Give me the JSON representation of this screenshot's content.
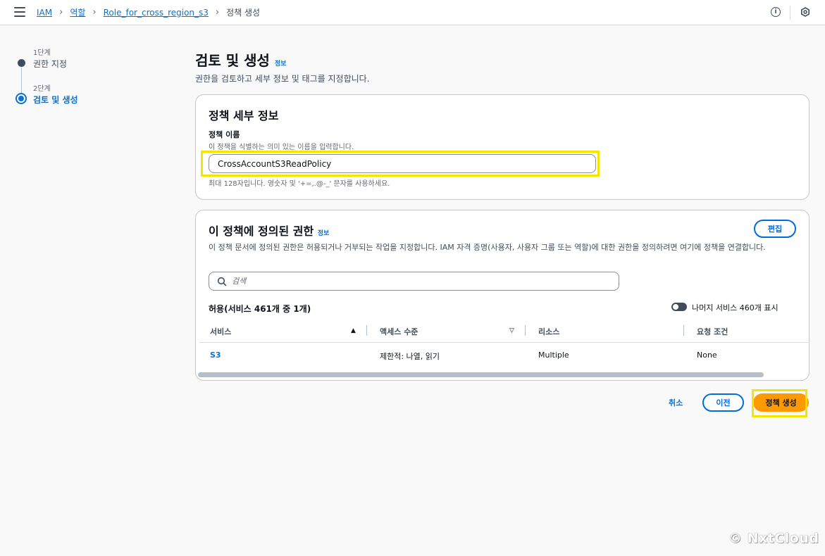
{
  "breadcrumb": {
    "items": [
      "IAM",
      "역할",
      "Role_for_cross_region_s3"
    ],
    "current": "정책 생성"
  },
  "icons": {
    "menu": "hamburger-menu-icon",
    "info": "info-icon",
    "settings": "settings-icon",
    "search": "search-icon",
    "sort": "sort-icon"
  },
  "steps": [
    {
      "num": "1단계",
      "label": "권한 지정"
    },
    {
      "num": "2단계",
      "label": "검토 및 생성"
    }
  ],
  "header": {
    "title": "검토 및 생성",
    "info": "정보",
    "description": "권한을 검토하고 세부 정보 및 태그를 지정합니다."
  },
  "policy_details": {
    "title": "정책 세부 정보",
    "name_label": "정책 이름",
    "name_desc": "이 정책을 식별하는 의미 있는 이름을 입력합니다.",
    "name_value": "CrossAccountS3ReadPolicy",
    "name_constraint": "최대 128자입니다. 영숫자 및 '+=,.@-_' 문자를 사용하세요."
  },
  "permissions": {
    "title": "이 정책에 정의된 권한",
    "info": "정보",
    "edit_label": "편집",
    "description": "이 정책 문서에 정의된 권한은 허용되거나 거부되는 작업을 지정합니다. IAM 자격 증명(사용자, 사용자 그룹 또는 역할)에 대한 권한을 정의하려면 여기에 정책을 연결합니다.",
    "search_placeholder": "검색",
    "allow_title": "허용(서비스 461개 중 1개)",
    "toggle_label": "나머지 서비스 460개 표시",
    "columns": [
      "서비스",
      "액세스 수준",
      "리소스",
      "요청 조건"
    ],
    "rows": [
      {
        "service": "S3",
        "access": "제한적: 나열, 읽기",
        "resource": "Multiple",
        "condition": "None"
      }
    ]
  },
  "footer": {
    "cancel": "취소",
    "previous": "이전",
    "create": "정책 생성"
  },
  "watermark": "© NxtCloud",
  "colors": {
    "link": "#0972d3",
    "primary_button": "#ff9900",
    "highlight": "#f2e600"
  }
}
